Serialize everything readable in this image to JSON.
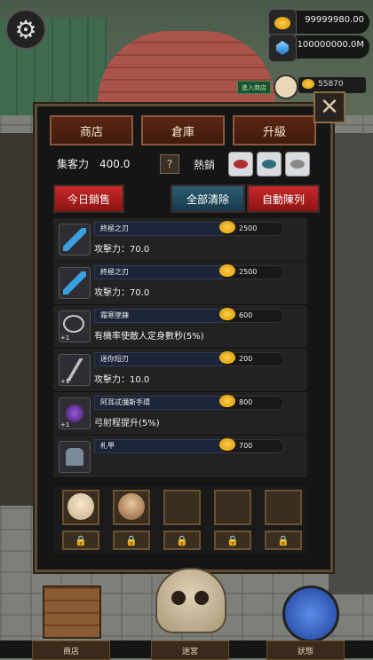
{
  "hud": {
    "gold": "99999980.00",
    "gems": "100000000.0M",
    "enter_shop_label": "進入商店",
    "mini_gold": "55870"
  },
  "tabs": [
    "商店",
    "倉庫",
    "升級"
  ],
  "stats": {
    "draw_label": "集客力",
    "draw_value": "400.0",
    "help_glyph": "?",
    "hot_label": "熱銷"
  },
  "buttons": {
    "today_sales": "今日銷售",
    "clear_all": "全部清除",
    "auto_display": "自動陳列"
  },
  "items": [
    {
      "name": "終極之刃",
      "price": "2500",
      "desc": "攻擊力：70.0",
      "level": "",
      "icon": "blue-sword-icon"
    },
    {
      "name": "終極之刃",
      "price": "2500",
      "desc": "攻擊力：70.0",
      "level": "",
      "icon": "blue-sword-icon"
    },
    {
      "name": "霜寒墜鍊",
      "price": "600",
      "desc": "有機率使敵人定身數秒(5%)",
      "level": "+1",
      "icon": "necklace-icon"
    },
    {
      "name": "迷你短刃",
      "price": "200",
      "desc": "攻擊力：10.0",
      "level": "+1",
      "icon": "dagger-icon"
    },
    {
      "name": "阿耳忒彌斯手環",
      "price": "800",
      "desc": "弓射程提升(5%)",
      "level": "+1",
      "icon": "bracelet-icon"
    },
    {
      "name": "札甲",
      "price": "700",
      "desc": "",
      "level": "",
      "icon": "armor-icon"
    }
  ],
  "nav": [
    "商店",
    "迷宮",
    "狀態"
  ],
  "colors": {
    "accent_red": "#c62828",
    "accent_teal": "#2b5d73",
    "panel_border": "#5a4a36",
    "coin": "#f0b21c"
  }
}
